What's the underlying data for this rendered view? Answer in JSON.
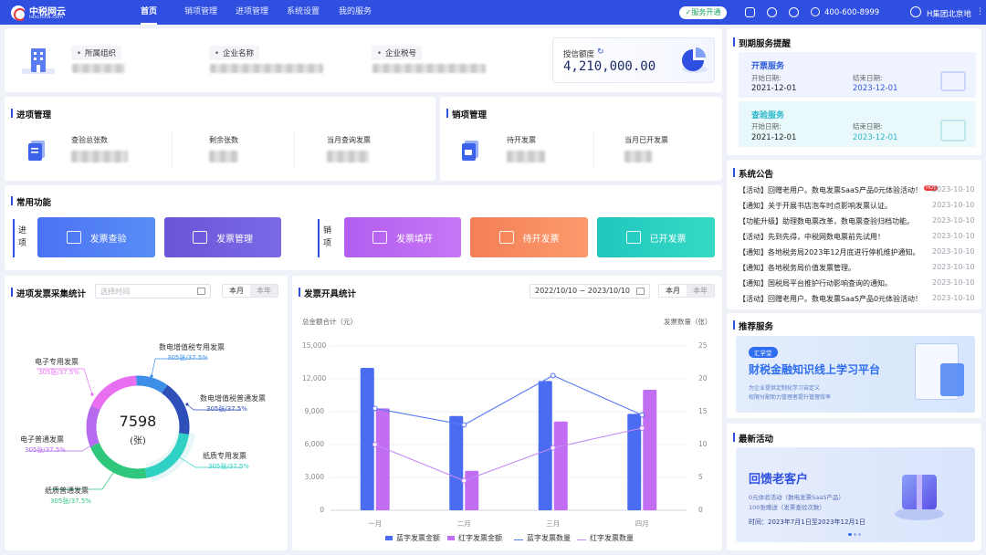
{
  "topbar": {
    "brand": "中税网云",
    "domain": "taxchina.com",
    "nav": [
      "首页",
      "销项管理",
      "进项管理",
      "系统设置",
      "我的服务"
    ],
    "service_badge": "✓服务开通",
    "phone": "400-600-8999",
    "company": "H集团北京地"
  },
  "org": {
    "labels": [
      "所属组织",
      "企业名称",
      "企业税号"
    ],
    "credit_label": "授信额度",
    "credit_value": "4,210,000.00"
  },
  "input_mgmt": {
    "title": "进项管理",
    "stats": [
      "查验总张数",
      "剩余张数",
      "当月查询发票"
    ]
  },
  "output_mgmt": {
    "title": "销项管理",
    "stats": [
      "待开发票",
      "当月已开发票"
    ]
  },
  "functions": {
    "title": "常用功能",
    "input_group": "进\n项",
    "output_group": "销\n项",
    "buttons": [
      "发票查验",
      "发票管理",
      "发票填开",
      "待开发票",
      "已开发票"
    ]
  },
  "collect_stats": {
    "title": "进项发票采集统计",
    "date_placeholder": "选择时间",
    "seg": [
      "本月",
      "本年"
    ],
    "total": "7598",
    "unit": "(张)",
    "items": [
      {
        "name": "电子专用发票",
        "sub": "305张/37.5%",
        "color": "#e86ff0"
      },
      {
        "name": "数电增值税专用发票",
        "sub": "305张/37.5%",
        "color": "#3d8fe8"
      },
      {
        "name": "数电增值税普通发票",
        "sub": "305张/37.5%",
        "color": "#2f4fb8"
      },
      {
        "name": "电子普通发票",
        "sub": "305张/37.5%",
        "color": "#b56af0"
      },
      {
        "name": "纸质专用发票",
        "sub": "305张/37.5%",
        "color": "#2fd1c4"
      },
      {
        "name": "纸质普通发票",
        "sub": "305张/37.5%",
        "color": "#2ec77c"
      }
    ]
  },
  "invoice_stats": {
    "title": "发票开具统计",
    "date_range": "2022/10/10 ~ 2023/10/10",
    "seg": [
      "本月",
      "本年"
    ]
  },
  "chart_data": {
    "type": "bar",
    "categories": [
      "一月",
      "二月",
      "三月",
      "四月"
    ],
    "ylabel_left": "总金额合计（元）",
    "ylabel_right": "发票数量（张）",
    "yticks_left": [
      "15,000",
      "12,000",
      "9,000",
      "6,000",
      "3,000",
      "0"
    ],
    "yticks_right": [
      "25",
      "20",
      "15",
      "10",
      "5",
      "0"
    ],
    "ylim_left": [
      0,
      15000
    ],
    "ylim_right": [
      0,
      25
    ],
    "series": [
      {
        "name": "蓝字发票金额",
        "kind": "bar",
        "axis": "left",
        "color": "#4a6cf0",
        "values": [
          13000,
          8600,
          11800,
          8800
        ]
      },
      {
        "name": "红字发票金额",
        "kind": "bar",
        "axis": "left",
        "color": "#c16ef2",
        "values": [
          9300,
          3600,
          8100,
          11000
        ]
      },
      {
        "name": "蓝字发票数量",
        "kind": "line",
        "axis": "right",
        "color": "#5a7af5",
        "values": [
          15.5,
          13,
          20.5,
          14.5
        ]
      },
      {
        "name": "红字发票数量",
        "kind": "line",
        "axis": "right",
        "color": "#c48af2",
        "values": [
          10,
          4.5,
          9.5,
          12.5
        ]
      }
    ]
  },
  "expiry": {
    "title": "到期服务提醒",
    "items": [
      {
        "name": "开票服务",
        "start_label": "开始日期:",
        "start": "2021-12-01",
        "end_label": "结束日期:",
        "end": "2023-12-01",
        "color": "#2f5bd9"
      },
      {
        "name": "查验服务",
        "start_label": "开始日期:",
        "start": "2021-12-01",
        "end_label": "结束日期:",
        "end": "2023-12-01",
        "color": "#2bb7c9"
      }
    ]
  },
  "announcements": {
    "title": "系统公告",
    "hot_badge": "HOT",
    "items": [
      {
        "text": "【活动】回赠老用户。数电发票SaaS产品0元体验活动！",
        "date": "2023-10-10"
      },
      {
        "text": "【通知】关于开展书店泡车时点影响发票认证。",
        "date": "2023-10-10"
      },
      {
        "text": "【功能升级】助理数电票改革，数电票查验归档功能。",
        "date": "2023-10-10"
      },
      {
        "text": "【活动】先到先得，中税网数电票前先试用！",
        "date": "2023-10-10"
      },
      {
        "text": "【通知】各地税务局2023年12月底进行停机维护通知。",
        "date": "2023-10-10"
      },
      {
        "text": "【通知】各地税务局价值发票管理。",
        "date": "2023-10-10"
      },
      {
        "text": "【通知】国税局平台推护行动影响查询的通知。",
        "date": "2023-10-10"
      },
      {
        "text": "【活动】回赠老用户。数电发票SaaS产品0元体验活动！",
        "date": "2023-10-10"
      }
    ]
  },
  "recommend": {
    "title": "推荐服务",
    "tag": "汇学堂",
    "headline": "财税金融知识线上学习平台",
    "line1": "为企业提供定制化学习自定义",
    "line2": "权限分配助力管理者提升管理效率"
  },
  "activity": {
    "title": "最新活动",
    "headline": "回馈老客户",
    "line1": "0元体验活动（数电发票SaaS产品）",
    "line2": "100张赠送（发票查验次数）",
    "time": "时间：2023年7月1日至2023年12月1日"
  }
}
